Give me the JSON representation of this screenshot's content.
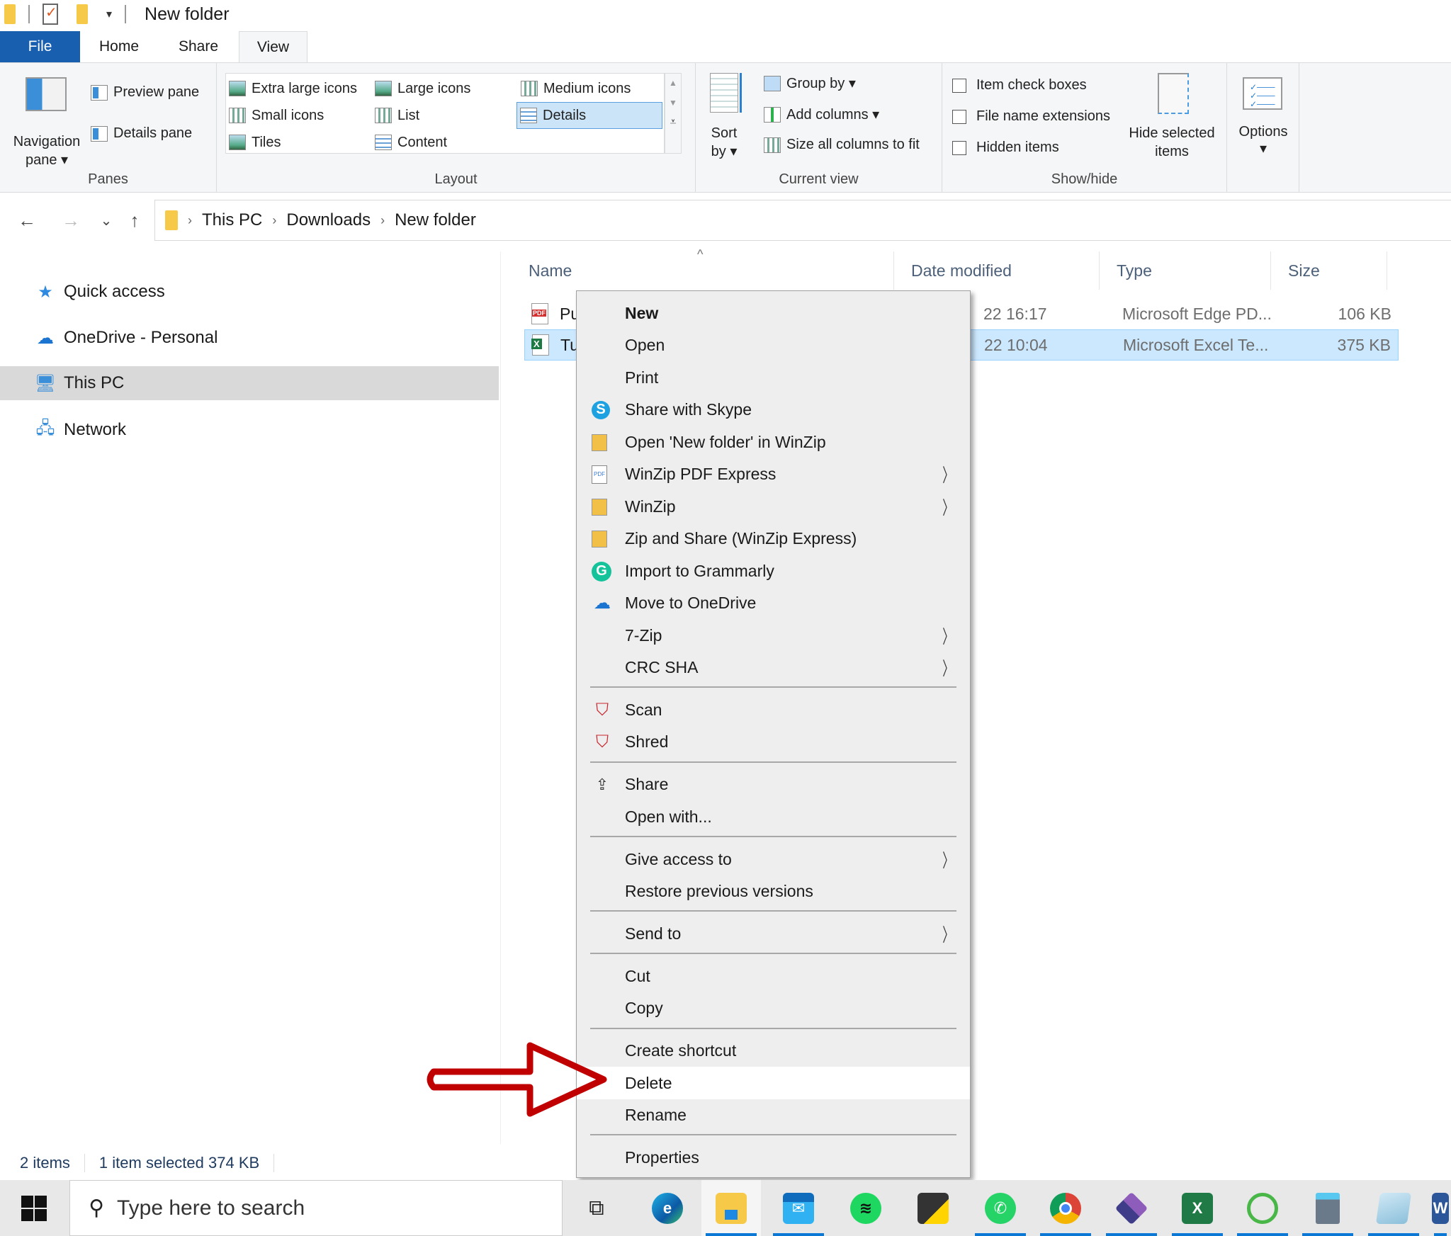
{
  "window": {
    "title": "New folder",
    "quick_access_icons": [
      "folder-icon",
      "properties-icon",
      "new-folder-icon",
      "customize-dropdown-icon"
    ]
  },
  "ribbon_tabs": [
    {
      "label": "File",
      "active": false
    },
    {
      "label": "Home",
      "active": false
    },
    {
      "label": "Share",
      "active": false
    },
    {
      "label": "View",
      "active": true
    }
  ],
  "ribbon": {
    "panes": {
      "label": "Panes",
      "navigation_pane": "Navigation",
      "navigation_pane_line2": "pane ▾",
      "preview_pane": "Preview pane",
      "details_pane": "Details pane"
    },
    "layout": {
      "label": "Layout",
      "options": [
        {
          "label": "Extra large icons",
          "selected": false
        },
        {
          "label": "Large icons",
          "selected": false
        },
        {
          "label": "Medium icons",
          "selected": false
        },
        {
          "label": "Small icons",
          "selected": false
        },
        {
          "label": "List",
          "selected": false
        },
        {
          "label": "Details",
          "selected": true
        },
        {
          "label": "Tiles",
          "selected": false
        },
        {
          "label": "Content",
          "selected": false
        }
      ]
    },
    "current_view": {
      "label": "Current view",
      "sort_by": "Sort",
      "sort_by_line2": "by ▾",
      "group_by": "Group by ▾",
      "add_columns": "Add columns ▾",
      "size_all_columns": "Size all columns to fit"
    },
    "show_hide": {
      "label": "Show/hide",
      "checkboxes": [
        {
          "label": "Item check boxes",
          "checked": false
        },
        {
          "label": "File name extensions",
          "checked": false
        },
        {
          "label": "Hidden items",
          "checked": false
        }
      ],
      "hide_selected": "Hide selected",
      "hide_selected_line2": "items"
    },
    "options": {
      "label": "Options",
      "caret": "▾"
    }
  },
  "navigation": {
    "back": "←",
    "forward": "→",
    "recent": "⌄",
    "up": "↑",
    "breadcrumb": [
      "This PC",
      "Downloads",
      "New folder"
    ],
    "separator": "›"
  },
  "nav_pane": {
    "items": [
      {
        "label": "Quick access",
        "icon": "star-icon",
        "selected": false
      },
      {
        "label": "OneDrive - Personal",
        "icon": "cloud-icon",
        "selected": false
      },
      {
        "label": "This PC",
        "icon": "computer-icon",
        "selected": true
      },
      {
        "label": "Network",
        "icon": "network-icon",
        "selected": false
      }
    ]
  },
  "file_list": {
    "sort_indicator": "^",
    "columns": [
      "Name",
      "Date modified",
      "Type",
      "Size"
    ],
    "rows": [
      {
        "name": "Pu",
        "date": "22 16:17",
        "type": "Microsoft Edge PD...",
        "size": "106 KB",
        "icon": "pdf-file-icon",
        "selected": false
      },
      {
        "name": "Tu",
        "date": "22 10:04",
        "type": "Microsoft Excel Te...",
        "size": "375 KB",
        "icon": "excel-file-icon",
        "selected": true
      }
    ]
  },
  "status_bar": {
    "item_count": "2 items",
    "selection": "1 item selected  374 KB"
  },
  "context_menu": {
    "items": [
      {
        "label": "New",
        "bold": true
      },
      {
        "label": "Open"
      },
      {
        "label": "Print"
      },
      {
        "label": "Share with Skype",
        "icon": "skype-icon"
      },
      {
        "label": "Open 'New folder' in WinZip",
        "icon": "winzip-icon"
      },
      {
        "label": "WinZip PDF Express",
        "icon": "winzip-pdf-icon",
        "submenu": true
      },
      {
        "label": "WinZip",
        "icon": "winzip-icon",
        "submenu": true
      },
      {
        "label": "Zip and Share (WinZip Express)",
        "icon": "winzip-icon"
      },
      {
        "label": "Import to Grammarly",
        "icon": "grammarly-icon"
      },
      {
        "label": "Move to OneDrive",
        "icon": "onedrive-icon"
      },
      {
        "label": "7-Zip",
        "submenu": true
      },
      {
        "label": "CRC SHA",
        "submenu": true
      },
      {
        "label": "Scan",
        "icon": "mcafee-icon"
      },
      {
        "label": "Shred",
        "icon": "mcafee-icon"
      },
      {
        "label": "Share",
        "icon": "share-icon"
      },
      {
        "label": "Open with..."
      },
      {
        "label": "Give access to",
        "submenu": true
      },
      {
        "label": "Restore previous versions"
      },
      {
        "label": "Send to",
        "submenu": true
      },
      {
        "label": "Cut"
      },
      {
        "label": "Copy"
      },
      {
        "label": "Create shortcut"
      },
      {
        "label": "Delete",
        "highlighted": true
      },
      {
        "label": "Rename"
      },
      {
        "label": "Properties"
      }
    ],
    "submenu_glyph": "〉",
    "skype_glyph": "S",
    "grammarly_glyph": "G",
    "pdf_glyph": "PDF"
  },
  "annotation": {
    "type": "red-arrow",
    "points_to": "Delete",
    "color": "#c00000"
  },
  "taskbar": {
    "search_placeholder": "Type here to search",
    "apps": [
      {
        "name": "task-view",
        "running": false
      },
      {
        "name": "edge",
        "running": false
      },
      {
        "name": "file-explorer",
        "running": true,
        "active": true
      },
      {
        "name": "mail",
        "running": true
      },
      {
        "name": "spotify",
        "running": false
      },
      {
        "name": "sticky-notes",
        "running": false
      },
      {
        "name": "whatsapp",
        "running": true
      },
      {
        "name": "chrome",
        "running": true
      },
      {
        "name": "visual-studio",
        "running": true
      },
      {
        "name": "excel",
        "running": true
      },
      {
        "name": "greenshot",
        "running": true
      },
      {
        "name": "calculator",
        "running": true
      },
      {
        "name": "notepad",
        "running": true
      },
      {
        "name": "word",
        "running": true
      }
    ]
  },
  "colors": {
    "accent": "#195fb0",
    "selection": "#cce8ff",
    "selection_border": "#99d1ff",
    "menu_bg": "#eeeeee",
    "annotation": "#c00000"
  }
}
